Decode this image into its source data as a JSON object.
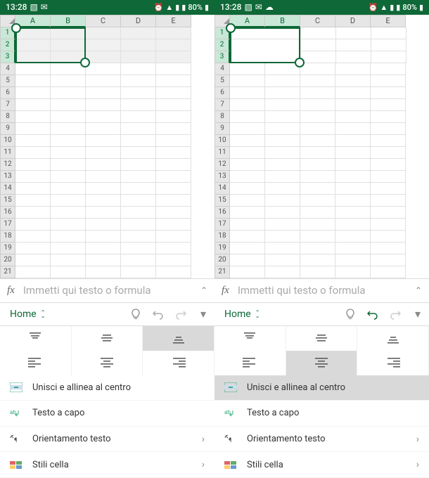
{
  "status": {
    "time": "13:28",
    "battery": "80%",
    "icons_left": [
      "picture-icon",
      "chat-icon"
    ],
    "icons_right": [
      "alarm-icon",
      "wifi-icon",
      "signal-icon",
      "signal-icon",
      "battery-icon"
    ]
  },
  "grid": {
    "columns": [
      "A",
      "B",
      "C",
      "D",
      "E"
    ],
    "rows": [
      "1",
      "2",
      "3",
      "4",
      "5",
      "6",
      "7",
      "8",
      "9",
      "10",
      "11",
      "12",
      "13",
      "14",
      "15",
      "16",
      "17",
      "18",
      "19",
      "20",
      "21"
    ],
    "selection": {
      "cols": [
        "A",
        "B"
      ],
      "rows": [
        "1",
        "2",
        "3"
      ]
    }
  },
  "formula_bar": {
    "fx_label": "fx",
    "placeholder": "Immetti qui testo o formula"
  },
  "ribbon": {
    "tab_label": "Home"
  },
  "left_pane": {
    "valign_active": null,
    "halign_active": null,
    "merge_active": false
  },
  "right_pane": {
    "valign_active": 2,
    "halign_active": 1,
    "merge_active": true
  },
  "menu": {
    "merge_label": "Unisci e allinea al centro",
    "wrap_label": "Testo a capo",
    "orient_label": "Orientamento testo",
    "styles_label": "Stili cella"
  }
}
